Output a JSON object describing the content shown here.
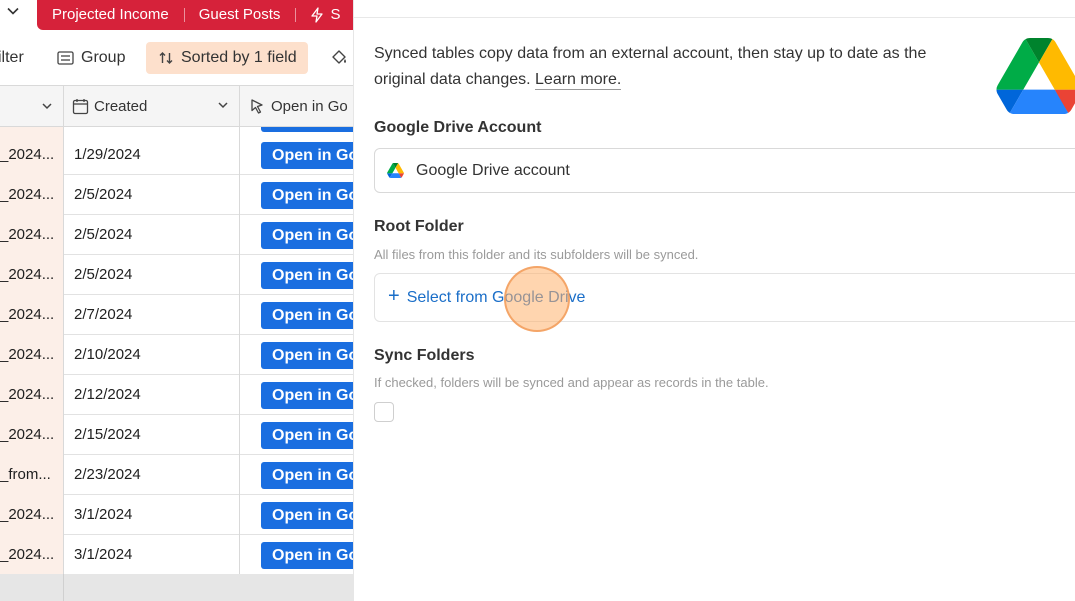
{
  "tabs": {
    "items": [
      "Projected Income",
      "Guest Posts",
      "S"
    ]
  },
  "toolbar": {
    "filter_label": "ilter",
    "group_label": "Group",
    "sort_label": "Sorted by 1 field"
  },
  "table": {
    "columns": {
      "created": "Created",
      "open": "Open in Go"
    },
    "rows": [
      {
        "name": "_2024...",
        "created": "1/29/2024",
        "button": "Open in Go"
      },
      {
        "name": "_2024...",
        "created": "2/5/2024",
        "button": "Open in Go"
      },
      {
        "name": "_2024...",
        "created": "2/5/2024",
        "button": "Open in Go"
      },
      {
        "name": "_2024...",
        "created": "2/5/2024",
        "button": "Open in Go"
      },
      {
        "name": "_2024...",
        "created": "2/7/2024",
        "button": "Open in Go"
      },
      {
        "name": "_2024...",
        "created": "2/10/2024",
        "button": "Open in Go"
      },
      {
        "name": "_2024...",
        "created": "2/12/2024",
        "button": "Open in Go"
      },
      {
        "name": "_2024...",
        "created": "2/15/2024",
        "button": "Open in Go"
      },
      {
        "name": "_from...",
        "created": "2/23/2024",
        "button": "Open in Go"
      },
      {
        "name": "_2024...",
        "created": "3/1/2024",
        "button": "Open in Go"
      },
      {
        "name": "_2024...",
        "created": "3/1/2024",
        "button": "Open in Go"
      }
    ]
  },
  "panel": {
    "description": "Synced tables copy data from an external account, then stay up to date as the original data changes.",
    "learn_more": "Learn more.",
    "account": {
      "label": "Google Drive Account",
      "value": "Google Drive account"
    },
    "root_folder": {
      "label": "Root Folder",
      "help": "All files from this folder and its subfolders will be synced.",
      "action": "Select from Google Drive"
    },
    "sync_folders": {
      "label": "Sync Folders",
      "help": "If checked, folders will be synced and appear as records in the table.",
      "checked": false
    }
  },
  "colors": {
    "tab_red": "#d6223a",
    "button_blue": "#1a6ee0",
    "link_blue": "#1a6ec8",
    "sort_chip": "#fde0cc",
    "row_highlight": "#fcefe8"
  },
  "icons": {
    "tab_menu": "chevron-down-icon",
    "tab_extension": "bolt-icon",
    "group": "group-icon",
    "sort": "sort-arrows-icon",
    "color": "paint-bucket-icon",
    "created_field": "calendar-icon",
    "open_field": "cursor-icon",
    "provider": "google-drive-icon",
    "add": "plus-icon"
  }
}
